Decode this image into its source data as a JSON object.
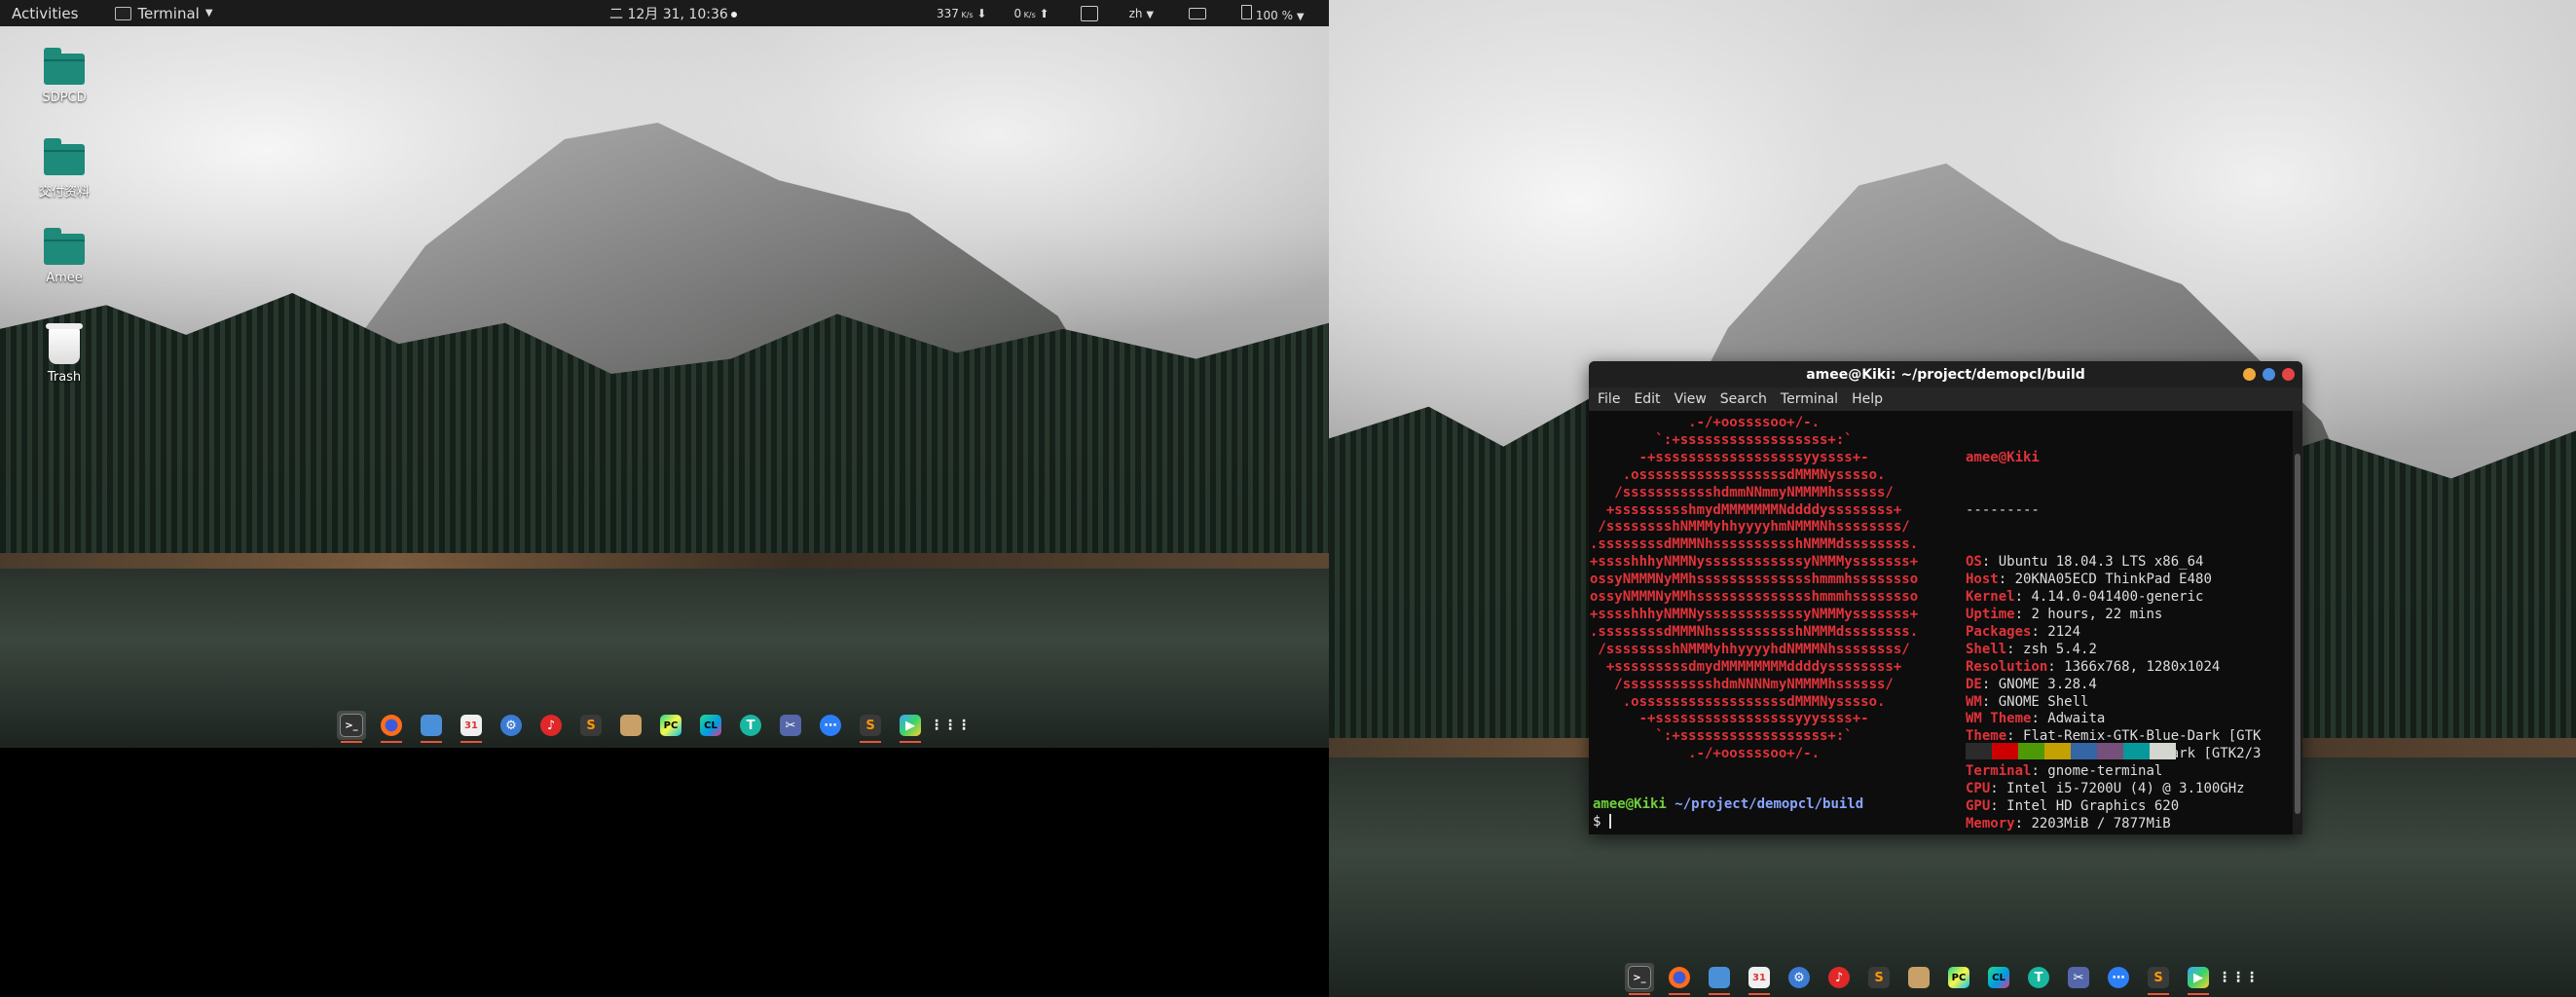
{
  "topbar": {
    "activities": "Activities",
    "app_menu": "Terminal",
    "clock": "二 12月 31, 10:36",
    "net_down": "337",
    "net_up": "0",
    "input_method": "zh",
    "battery": "100 %"
  },
  "desktop": {
    "icons": [
      {
        "label": "SDPCD"
      },
      {
        "label": "交付资料"
      },
      {
        "label": "Amee"
      },
      {
        "label": "Trash"
      }
    ]
  },
  "dock": {
    "apps": [
      "terminal-icon",
      "firefox-icon",
      "files-icon",
      "calendar-icon",
      "settings-icon",
      "netease-music-icon",
      "sublime-text-icon",
      "archive-icon",
      "pycharm-icon",
      "clion-icon",
      "typora-icon",
      "screenshot-icon",
      "chat-icon",
      "sublime-merge-icon",
      "player-icon",
      "app-grid-icon"
    ]
  },
  "terminal": {
    "title": "amee@Kiki: ~/project/demopcl/build",
    "menu": [
      "File",
      "Edit",
      "View",
      "Search",
      "Terminal",
      "Help"
    ],
    "logo": "            .-/+oossssoo+/-.\n        `:+ssssssssssssssssss+:`\n      -+ssssssssssssssssssyyssss+-\n    .ossssssssssssssssssdMMMNysssso.\n   /ssssssssssshdmmNNmmyNMMMMhssssss/\n  +ssssssssshmydMMMMMMMNddddyssssssss+\n /sssssssshNMMMyhhyyyyhmNMMMNhssssssss/\n.ssssssssdMMMNhsssssssssshNMMMdssssssss.\n+sssshhhyNMMNyssssssssssssyNMMMysssssss+\nossyNMMMNyMMhsssssssssssssshmmmhssssssso\nossyNMMMNyMMhsssssssssssssshmmmhssssssso\n+sssshhhyNMMNyssssssssssssyNMMMysssssss+\n.ssssssssdMMMNhsssssssssshNMMMdssssssss.\n /sssssssshNMMMyhhyyyyhdNMMMNhssssssss/\n  +sssssssssdmydMMMMMMMMddddyssssssss+\n   /ssssssssssshdmNNNNmyNMMMMhssssss/\n    .ossssssssssssssssssdMMMNysssso.\n      -+sssssssssssssssssyyyssss+-\n        `:+ssssssssssssssssss+:`\n            .-/+oossssoo+/-.",
    "user_host": "amee@Kiki",
    "separator": "---------",
    "info": [
      {
        "key": "OS",
        "value": "Ubuntu 18.04.3 LTS x86_64"
      },
      {
        "key": "Host",
        "value": "20KNA05ECD ThinkPad E480"
      },
      {
        "key": "Kernel",
        "value": "4.14.0-041400-generic"
      },
      {
        "key": "Uptime",
        "value": "2 hours, 22 mins"
      },
      {
        "key": "Packages",
        "value": "2124"
      },
      {
        "key": "Shell",
        "value": "zsh 5.4.2"
      },
      {
        "key": "Resolution",
        "value": "1366x768, 1280x1024"
      },
      {
        "key": "DE",
        "value": "GNOME 3.28.4"
      },
      {
        "key": "WM",
        "value": "GNOME Shell"
      },
      {
        "key": "WM Theme",
        "value": "Adwaita"
      },
      {
        "key": "Theme",
        "value": "Flat-Remix-GTK-Blue-Dark [GTK"
      },
      {
        "key": "Icons",
        "value": "Flat-Remix-Green-Dark [GTK2/3"
      },
      {
        "key": "Terminal",
        "value": "gnome-terminal"
      },
      {
        "key": "CPU",
        "value": "Intel i5-7200U (4) @ 3.100GHz"
      },
      {
        "key": "GPU",
        "value": "Intel HD Graphics 620"
      },
      {
        "key": "Memory",
        "value": "2203MiB / 7877MiB"
      }
    ],
    "palette": [
      "#2b2b2b",
      "#cc0000",
      "#4e9a06",
      "#c4a000",
      "#3465a4",
      "#75507b",
      "#06989a",
      "#d3d7cf"
    ],
    "prompt_user": "amee@Kiki",
    "prompt_path": "~/project/demopcl/build",
    "prompt_symbol": "$"
  }
}
